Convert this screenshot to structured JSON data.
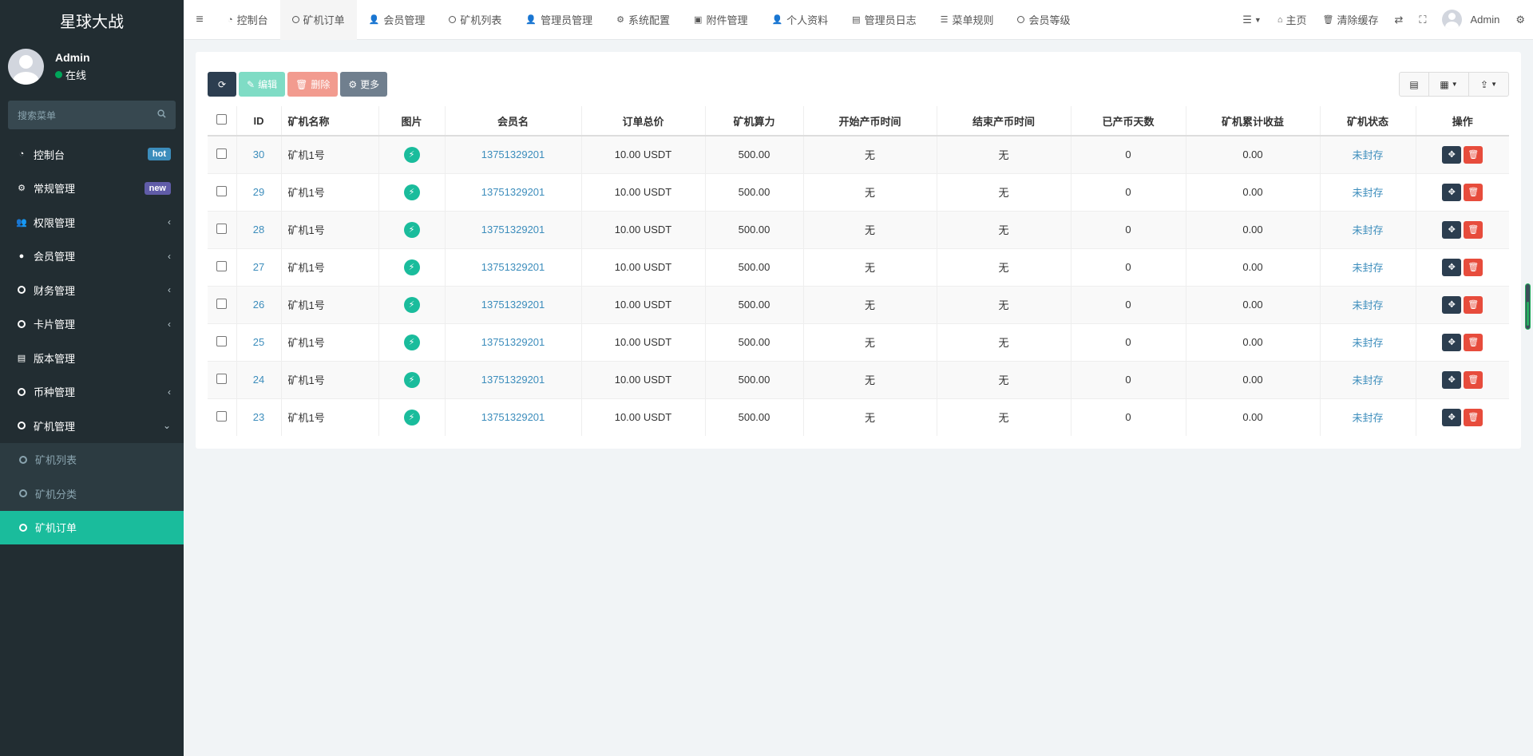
{
  "app": {
    "title": "星球大战"
  },
  "user": {
    "name": "Admin",
    "status": "在线"
  },
  "sidebar": {
    "search_placeholder": "搜索菜单",
    "items": [
      {
        "label": "控制台",
        "badge": "hot"
      },
      {
        "label": "常规管理",
        "badge": "new"
      },
      {
        "label": "权限管理"
      },
      {
        "label": "会员管理"
      },
      {
        "label": "财务管理"
      },
      {
        "label": "卡片管理"
      },
      {
        "label": "版本管理"
      },
      {
        "label": "币种管理"
      },
      {
        "label": "矿机管理"
      }
    ],
    "subitems": [
      {
        "label": "矿机列表"
      },
      {
        "label": "矿机分类"
      },
      {
        "label": "矿机订单"
      }
    ]
  },
  "topbar": {
    "tabs": [
      {
        "label": "控制台"
      },
      {
        "label": "矿机订单"
      },
      {
        "label": "会员管理"
      },
      {
        "label": "矿机列表"
      },
      {
        "label": "管理员管理"
      },
      {
        "label": "系统配置"
      },
      {
        "label": "附件管理"
      },
      {
        "label": "个人资料"
      },
      {
        "label": "管理员日志"
      },
      {
        "label": "菜单规则"
      },
      {
        "label": "会员等级"
      }
    ],
    "home": "主页",
    "clear_cache": "清除缓存",
    "user": "Admin"
  },
  "toolbar": {
    "edit": "编辑",
    "delete": "删除",
    "more": "更多"
  },
  "table": {
    "headers": [
      "ID",
      "矿机名称",
      "图片",
      "会员名",
      "订单总价",
      "矿机算力",
      "开始产币时间",
      "结束产币时间",
      "已产币天数",
      "矿机累计收益",
      "矿机状态",
      "操作"
    ],
    "rows": [
      {
        "id": "30",
        "name": "矿机1号",
        "member": "13751329201",
        "price": "10.00 USDT",
        "power": "500.00",
        "start": "无",
        "end": "无",
        "days": "0",
        "income": "0.00",
        "status": "未封存"
      },
      {
        "id": "29",
        "name": "矿机1号",
        "member": "13751329201",
        "price": "10.00 USDT",
        "power": "500.00",
        "start": "无",
        "end": "无",
        "days": "0",
        "income": "0.00",
        "status": "未封存"
      },
      {
        "id": "28",
        "name": "矿机1号",
        "member": "13751329201",
        "price": "10.00 USDT",
        "power": "500.00",
        "start": "无",
        "end": "无",
        "days": "0",
        "income": "0.00",
        "status": "未封存"
      },
      {
        "id": "27",
        "name": "矿机1号",
        "member": "13751329201",
        "price": "10.00 USDT",
        "power": "500.00",
        "start": "无",
        "end": "无",
        "days": "0",
        "income": "0.00",
        "status": "未封存"
      },
      {
        "id": "26",
        "name": "矿机1号",
        "member": "13751329201",
        "price": "10.00 USDT",
        "power": "500.00",
        "start": "无",
        "end": "无",
        "days": "0",
        "income": "0.00",
        "status": "未封存"
      },
      {
        "id": "25",
        "name": "矿机1号",
        "member": "13751329201",
        "price": "10.00 USDT",
        "power": "500.00",
        "start": "无",
        "end": "无",
        "days": "0",
        "income": "0.00",
        "status": "未封存"
      },
      {
        "id": "24",
        "name": "矿机1号",
        "member": "13751329201",
        "price": "10.00 USDT",
        "power": "500.00",
        "start": "无",
        "end": "无",
        "days": "0",
        "income": "0.00",
        "status": "未封存"
      },
      {
        "id": "23",
        "name": "矿机1号",
        "member": "13751329201",
        "price": "10.00 USDT",
        "power": "500.00",
        "start": "无",
        "end": "无",
        "days": "0",
        "income": "0.00",
        "status": "未封存"
      }
    ]
  },
  "colors": {
    "sidebar_bg": "#222d32",
    "accent": "#1abc9c",
    "link": "#3c8dbc",
    "danger": "#e74c3c"
  }
}
